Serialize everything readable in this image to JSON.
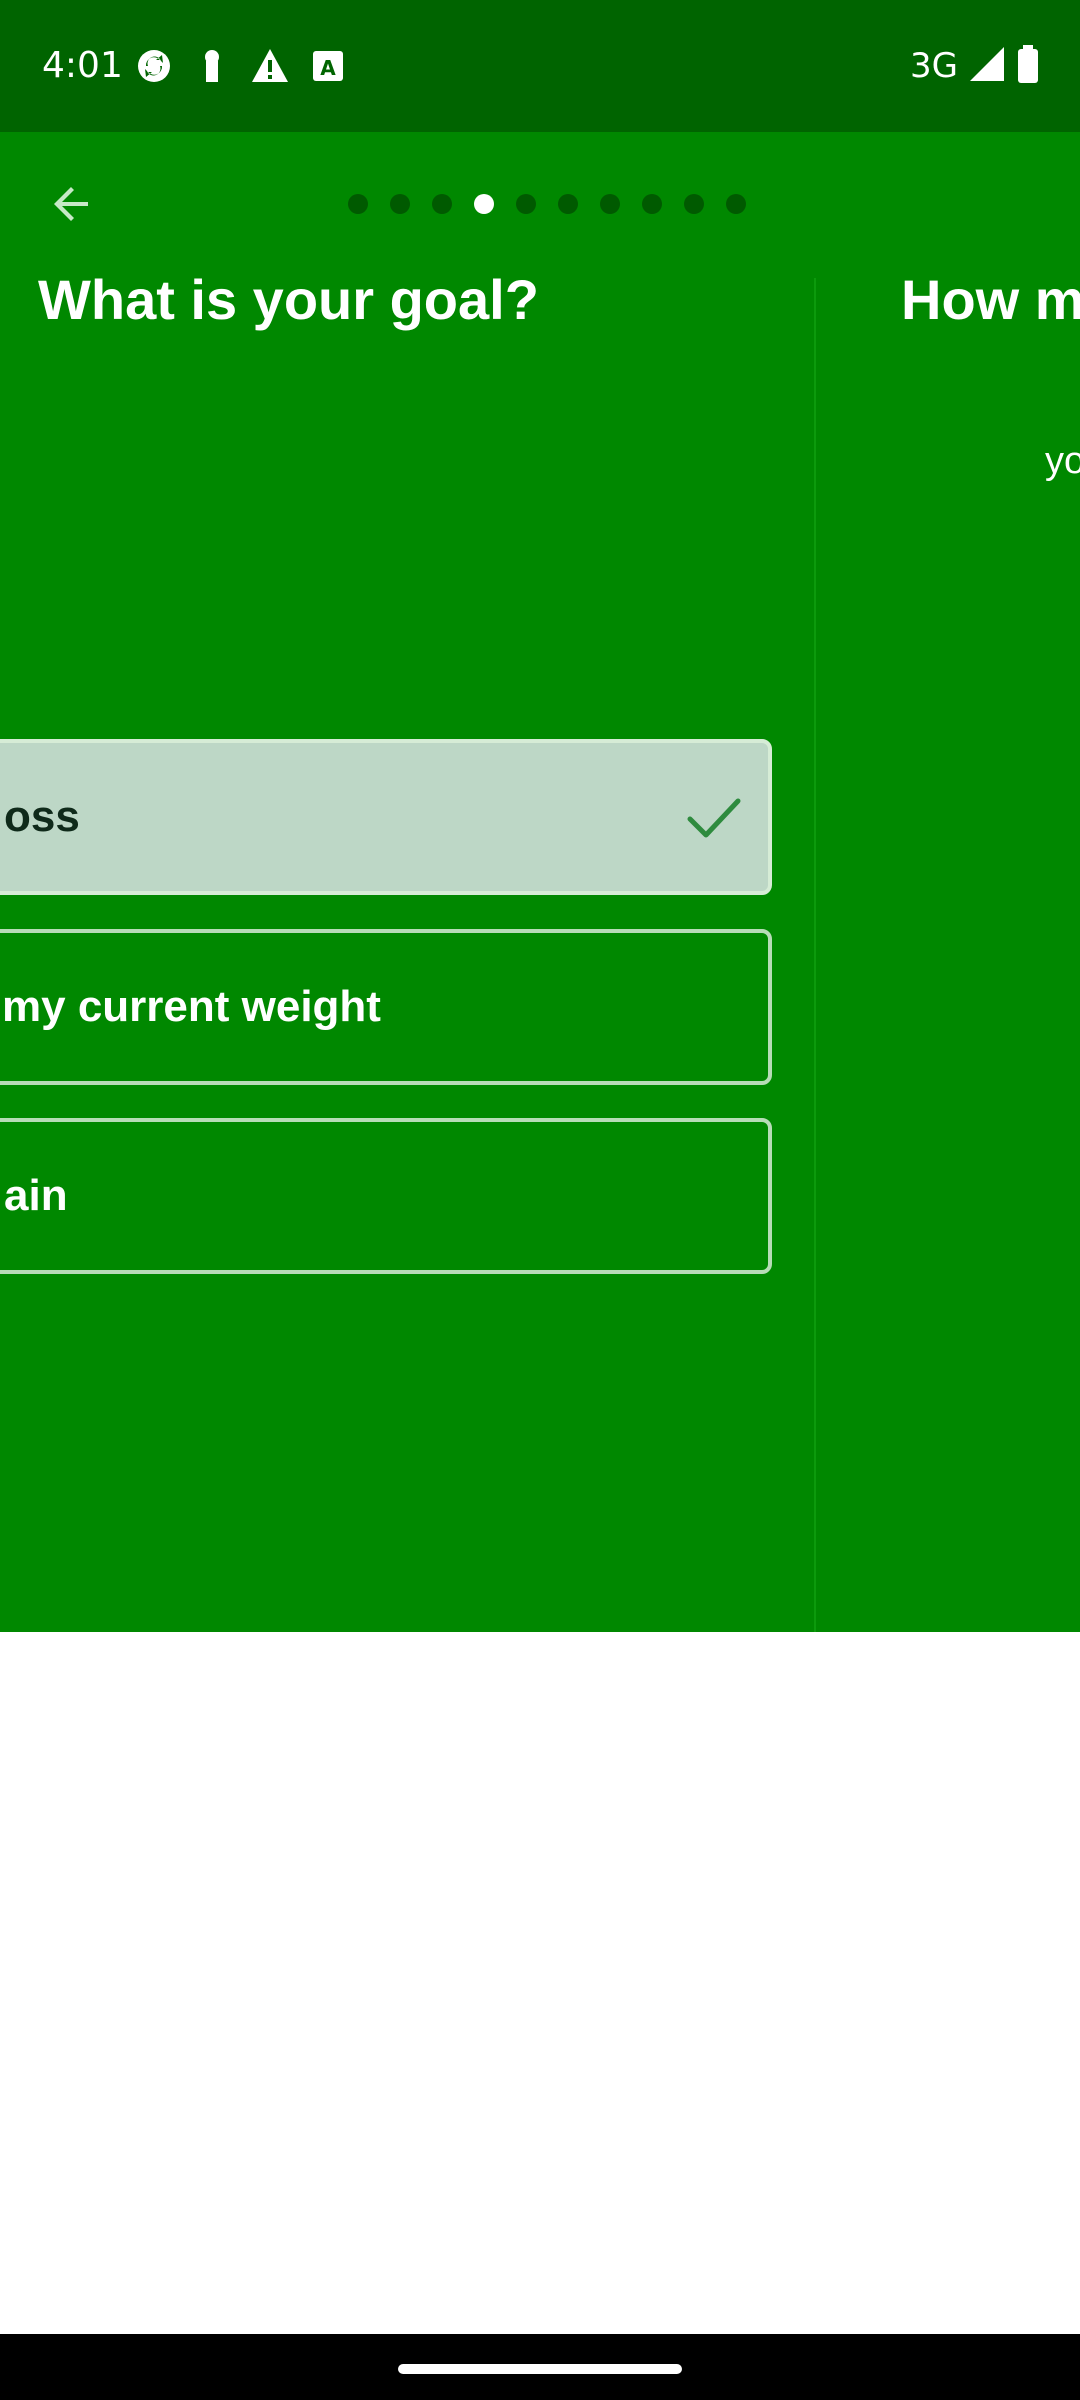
{
  "status_bar": {
    "time": "4:01",
    "network": "3G",
    "left_icons": [
      "sync-icon",
      "keyhole-icon",
      "warning-icon",
      "font-icon"
    ],
    "right_icons": [
      "signal-icon",
      "battery-icon"
    ]
  },
  "header": {
    "back_icon": "arrow-back-icon",
    "progress": {
      "total_steps": 10,
      "current_step": 4
    }
  },
  "pages": [
    {
      "title": "What is your goal?",
      "options": [
        {
          "label": "oss",
          "selected": true
        },
        {
          "label": " my current weight",
          "selected": false
        },
        {
          "label": "ain",
          "selected": false
        }
      ]
    },
    {
      "title": "How m",
      "subtitle": "yo"
    }
  ],
  "colors": {
    "status_bar": "#006400",
    "app_background": "#008800",
    "selected_option": "#bdd7c6",
    "check": "#2e8b3e"
  }
}
